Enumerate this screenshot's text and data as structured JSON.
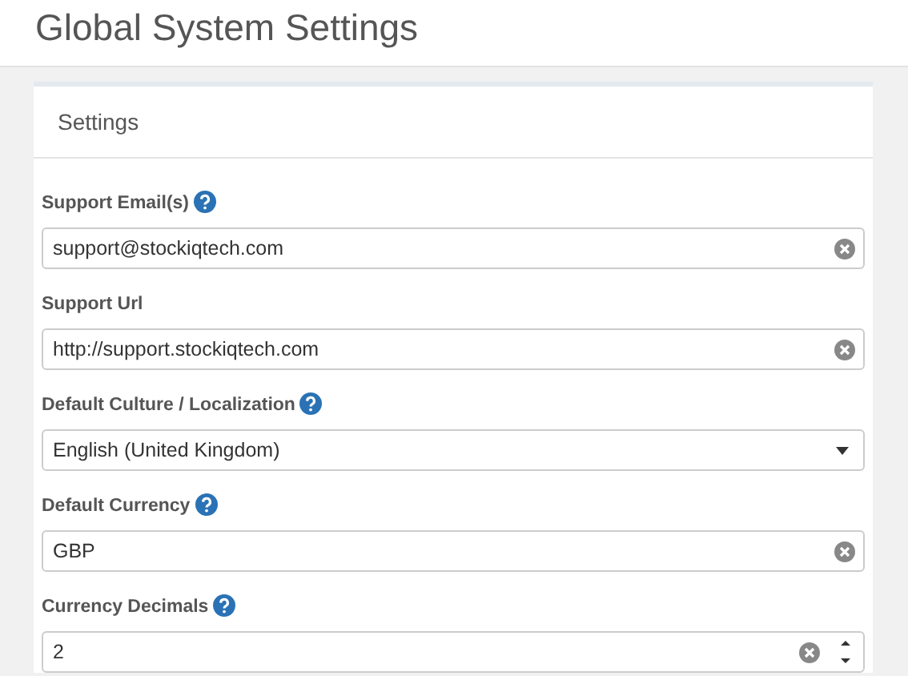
{
  "page": {
    "title": "Global System Settings"
  },
  "card": {
    "title": "Settings"
  },
  "fields": [
    {
      "label": "Support Email(s)",
      "help": true,
      "kind": "text",
      "value": "support@stockiqtech.com"
    },
    {
      "label": "Support Url",
      "help": false,
      "kind": "text",
      "value": "http://support.stockiqtech.com"
    },
    {
      "label": "Default Culture / Localization",
      "help": true,
      "kind": "select",
      "value": "English (United Kingdom)"
    },
    {
      "label": "Default Currency",
      "help": true,
      "kind": "text",
      "value": "GBP"
    },
    {
      "label": "Currency Decimals",
      "help": true,
      "kind": "number",
      "value": "2"
    }
  ]
}
